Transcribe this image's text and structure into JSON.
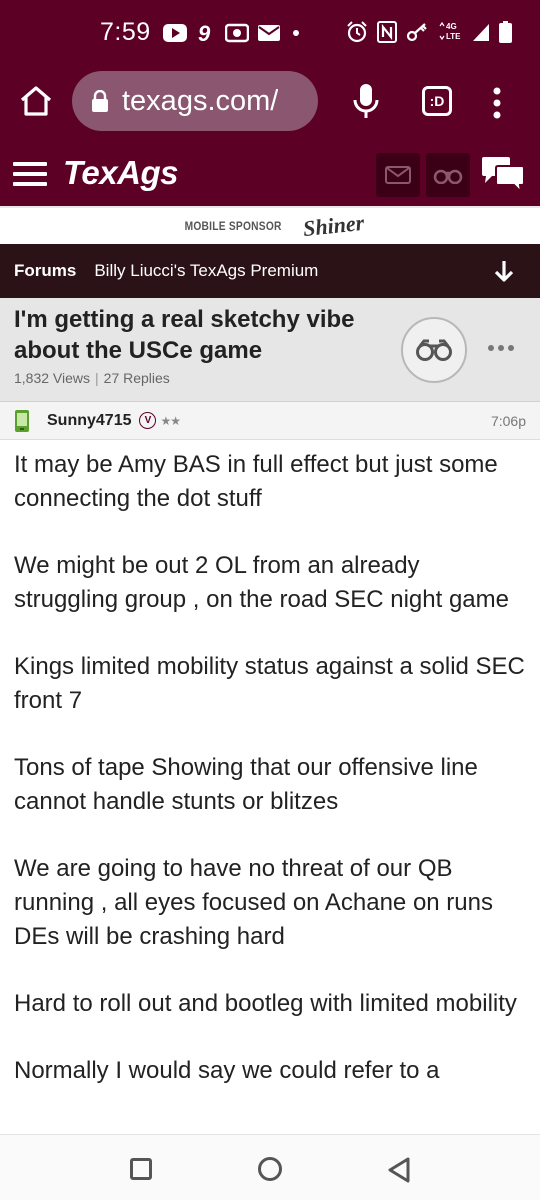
{
  "status_bar": {
    "time": "7:59",
    "left_icons": [
      "youtube-icon",
      "notification-9-icon",
      "radio-icon",
      "mail-icon",
      "dot-icon"
    ],
    "right_icons": [
      "alarm-icon",
      "nfc-icon",
      "key-icon",
      "lte-icon",
      "signal-icon",
      "battery-icon"
    ],
    "network_label_top": "4G",
    "network_label_bottom": "LTE"
  },
  "browser": {
    "url": "texags.com/",
    "tab_label": ":D"
  },
  "site": {
    "logo": "TexAgs"
  },
  "sponsor": {
    "label": "MOBILE SPONSOR",
    "brand": "Shiner"
  },
  "breadcrumb": {
    "forums": "Forums",
    "board": "Billy Liucci's TexAgs Premium"
  },
  "thread": {
    "title": "I'm getting a real sketchy vibe about the USCe game",
    "views": "1,832 Views",
    "separator": "|",
    "replies": "27 Replies"
  },
  "post": {
    "username": "Sunny4715",
    "badge": "V",
    "stars": "★★",
    "time": "7:06p",
    "paragraphs": [
      "It may be Amy BAS in full effect but just some connecting the dot stuff",
      "We might be out 2 OL from an already struggling group , on the road SEC night game",
      "Kings limited mobility status against a solid SEC front 7",
      "Tons of tape Showing that our offensive line cannot handle stunts or blitzes",
      "We are going to have no threat of our QB running , all eyes focused on Achane on runs DEs will be crashing hard",
      "Hard to roll out and bootleg with limited mobility",
      "Normally I would say we could refer to a"
    ]
  },
  "colors": {
    "brand_maroon": "#5c0025",
    "breadcrumb_bg": "#2a1216",
    "thread_header_bg": "#e6e6e6"
  }
}
